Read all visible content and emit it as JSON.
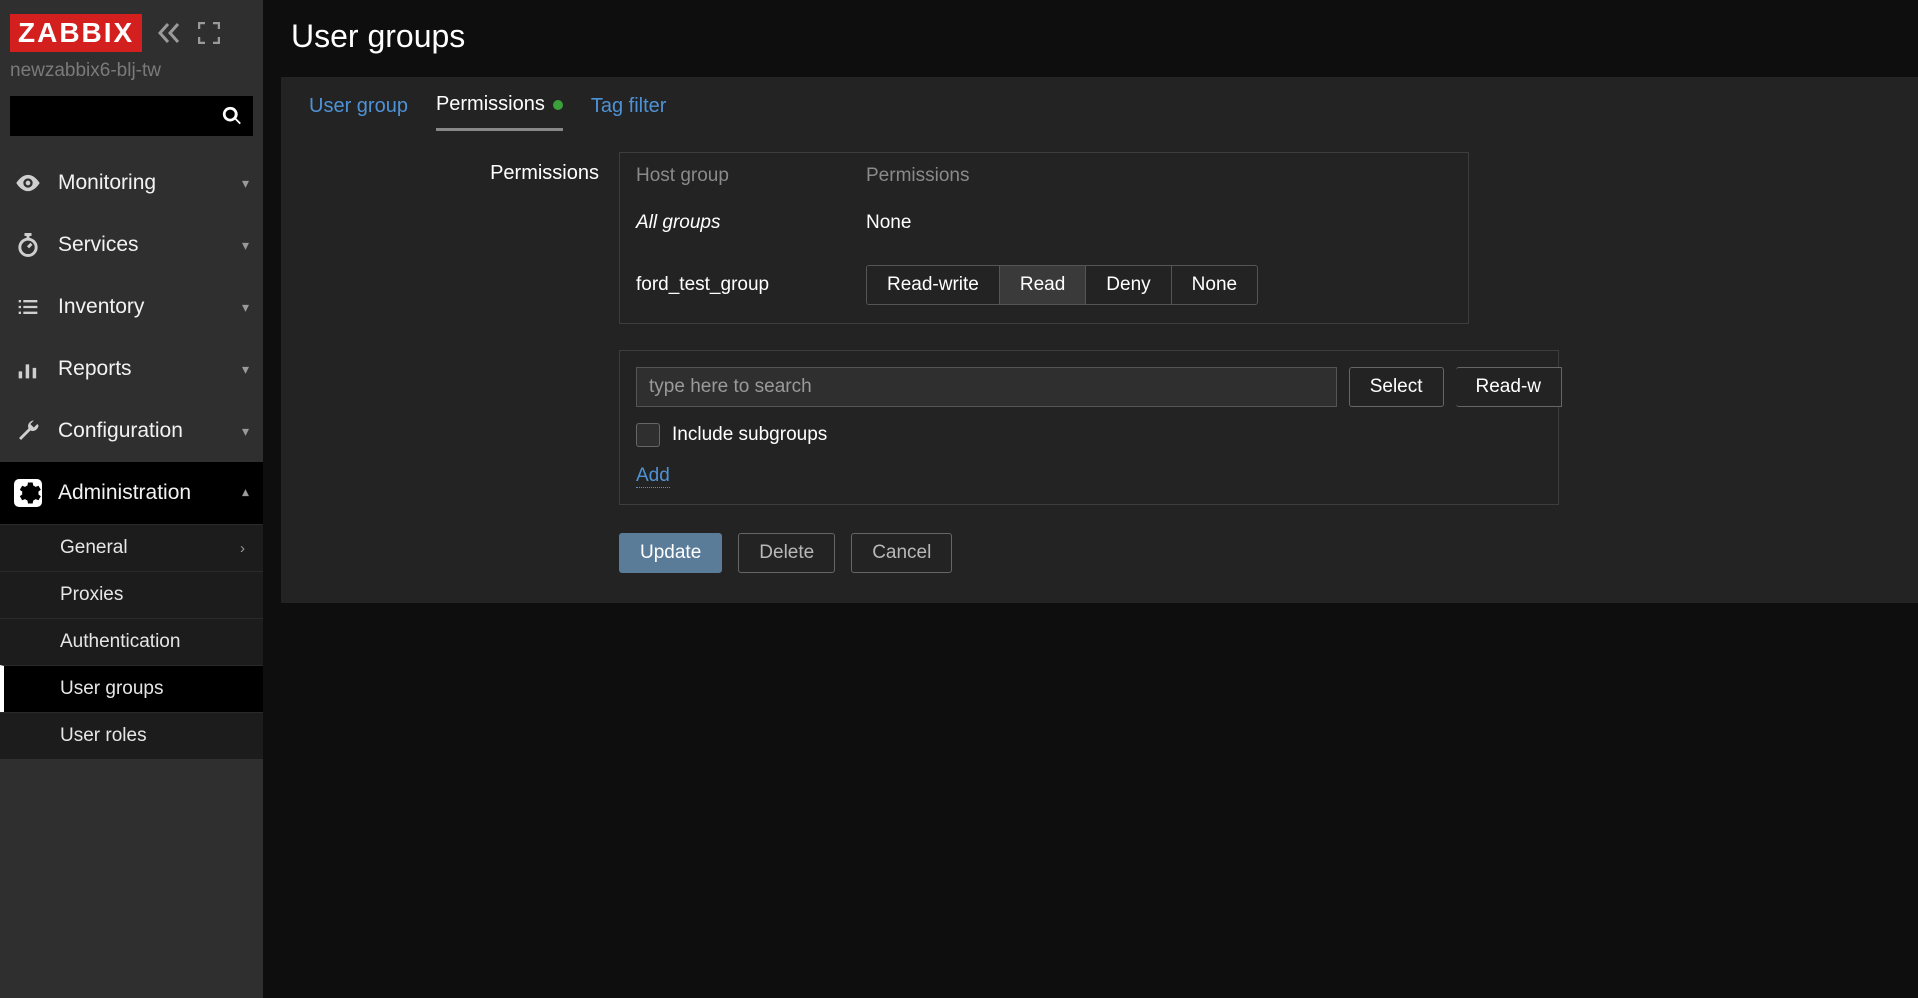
{
  "logo_text": "ZABBIX",
  "server_name": "newzabbix6-blj-tw",
  "nav": [
    {
      "label": "Monitoring"
    },
    {
      "label": "Services"
    },
    {
      "label": "Inventory"
    },
    {
      "label": "Reports"
    },
    {
      "label": "Configuration"
    },
    {
      "label": "Administration"
    }
  ],
  "admin_sub": [
    {
      "label": "General",
      "has_sub": true
    },
    {
      "label": "Proxies"
    },
    {
      "label": "Authentication"
    },
    {
      "label": "User groups",
      "active": true
    },
    {
      "label": "User roles"
    }
  ],
  "page_title": "User groups",
  "tabs": [
    {
      "label": "User group"
    },
    {
      "label": "Permissions",
      "active": true,
      "changed": true
    },
    {
      "label": "Tag filter"
    }
  ],
  "perm": {
    "section_label": "Permissions",
    "col_hostgroup": "Host group",
    "col_permissions": "Permissions",
    "all_groups_label": "All groups",
    "all_groups_value": "None",
    "rows": [
      {
        "hostgroup": "ford_test_group",
        "selected": "Read"
      }
    ],
    "seg_options": [
      "Read-write",
      "Read",
      "Deny",
      "None"
    ],
    "search_placeholder": "type here to search",
    "select_btn": "Select",
    "readwrite_btn": "Read-w",
    "include_subgroups": "Include subgroups",
    "add_link": "Add"
  },
  "actions": {
    "update": "Update",
    "delete": "Delete",
    "cancel": "Cancel"
  }
}
